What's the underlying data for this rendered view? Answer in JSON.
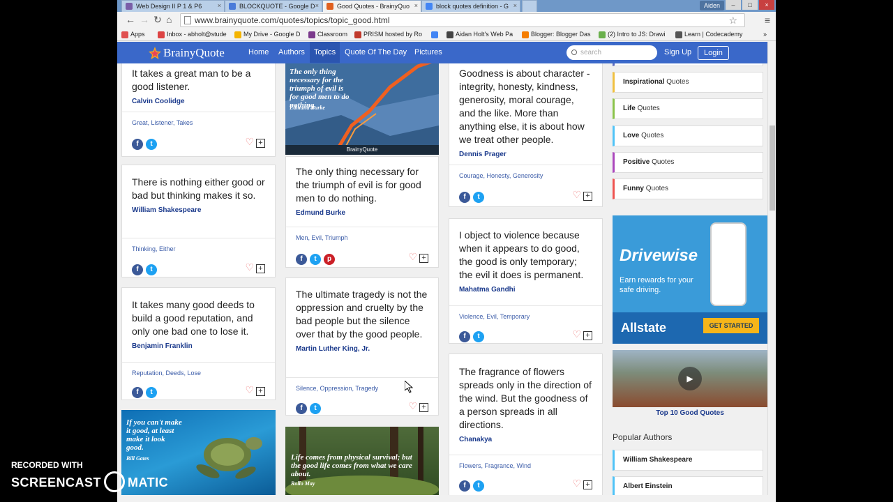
{
  "browser": {
    "tabs": [
      {
        "title": "Web Design II P 1 & P6",
        "color": "#7a5ea8"
      },
      {
        "title": "BLOCKQUOTE - Google D",
        "color": "#4a7bd9"
      },
      {
        "title": "Good Quotes - BrainyQuo",
        "color": "#e06020"
      },
      {
        "title": "block quotes definition - G",
        "color": "#4285f4"
      }
    ],
    "user": "Aiden",
    "url": "www.brainyquote.com/quotes/topics/topic_good.html",
    "bookmarks": [
      {
        "label": "Apps",
        "color": "#e05050"
      },
      {
        "label": "Inbox - abholt@stude",
        "color": "#d44"
      },
      {
        "label": "My Drive - Google D",
        "color": "#f4b400"
      },
      {
        "label": "Classroom",
        "color": "#7b3a8c"
      },
      {
        "label": "PRISM hosted by Ro",
        "color": "#c0392b"
      },
      {
        "label": "",
        "color": "#4285f4"
      },
      {
        "label": "Aidan Holt's Web Pa",
        "color": "#444"
      },
      {
        "label": "Blogger: Blogger Das",
        "color": "#f57d00"
      },
      {
        "label": "(2) Intro to JS: Drawi",
        "color": "#6ab04c"
      },
      {
        "label": "Learn | Codecademy",
        "color": "#555"
      }
    ]
  },
  "site": {
    "logo": "BrainyQuote",
    "nav": [
      "Home",
      "Authors",
      "Topics",
      "Quote Of The Day",
      "Pictures"
    ],
    "search_placeholder": "search",
    "signup": "Sign Up",
    "login": "Login"
  },
  "quotes": {
    "col1": [
      {
        "text": "It takes a great man to be a good listener.",
        "author": "Calvin Coolidge",
        "tags": "Great, Listener, Takes"
      },
      {
        "text": "There is nothing either good or bad but thinking makes it so.",
        "author": "William Shakespeare",
        "tags": "Thinking, Either"
      },
      {
        "text": "It takes many good deeds to build a good reputation, and only one bad one to lose it.",
        "author": "Benjamin Franklin",
        "tags": "Reputation, Deeds, Lose"
      }
    ],
    "col2": [
      {
        "text": "The only thing necessary for the triumph of evil is for good men to do nothing.",
        "author": "Edmund Burke",
        "tags": "Men, Evil, Triumph"
      },
      {
        "text": "The ultimate tragedy is not the oppression and cruelty by the bad people but the silence over that by the good people.",
        "author": "Martin Luther King, Jr.",
        "tags": "Silence, Oppression, Tragedy"
      }
    ],
    "col3": [
      {
        "text": "Goodness is about character - integrity, honesty, kindness, generosity, moral courage, and the like. More than anything else, it is about how we treat other people.",
        "author": "Dennis Prager",
        "tags": "Courage, Honesty, Generosity"
      },
      {
        "text": "I object to violence because when it appears to do good, the good is only temporary; the evil it does is permanent.",
        "author": "Mahatma Gandhi",
        "tags": "Violence, Evil, Temporary"
      },
      {
        "text": "The fragrance of flowers spreads only in the direction of the wind. But the goodness of a person spreads in all directions.",
        "author": "Chanakya",
        "tags": "Flowers, Fragrance, Wind"
      }
    ]
  },
  "images": {
    "burke": {
      "text": "The only thing necessary for the triumph of evil is for good men to do nothing.",
      "caption": "Edmund Burke",
      "brand": "BrainyQuote"
    },
    "gates": {
      "text": "If you can't make it good, at least make it look good.",
      "caption": "Bill Gates"
    },
    "may": {
      "text": "Life comes from physical survival; but the good life comes from what we care about.",
      "caption": "Rollo May"
    }
  },
  "sidebar": {
    "topics": [
      {
        "name": "Inspirational",
        "suffix": "Quotes",
        "color": "#f0c040"
      },
      {
        "name": "Life",
        "suffix": "Quotes",
        "color": "#8bc34a"
      },
      {
        "name": "Love",
        "suffix": "Quotes",
        "color": "#4fc3f7"
      },
      {
        "name": "Positive",
        "suffix": "Quotes",
        "color": "#ab47bc"
      },
      {
        "name": "Funny",
        "suffix": "Quotes",
        "color": "#ef5350"
      }
    ],
    "ad": {
      "title": "Drivewise",
      "sub": "Earn rewards for your safe driving.",
      "brand": "Allstate",
      "cta": "GET STARTED"
    },
    "video_caption": "Top 10 Good Quotes",
    "popular_title": "Popular Authors",
    "authors": [
      "William Shakespeare",
      "Albert Einstein"
    ]
  },
  "watermark": {
    "top": "RECORDED WITH",
    "left": "SCREENCAST",
    "right": "MATIC"
  }
}
